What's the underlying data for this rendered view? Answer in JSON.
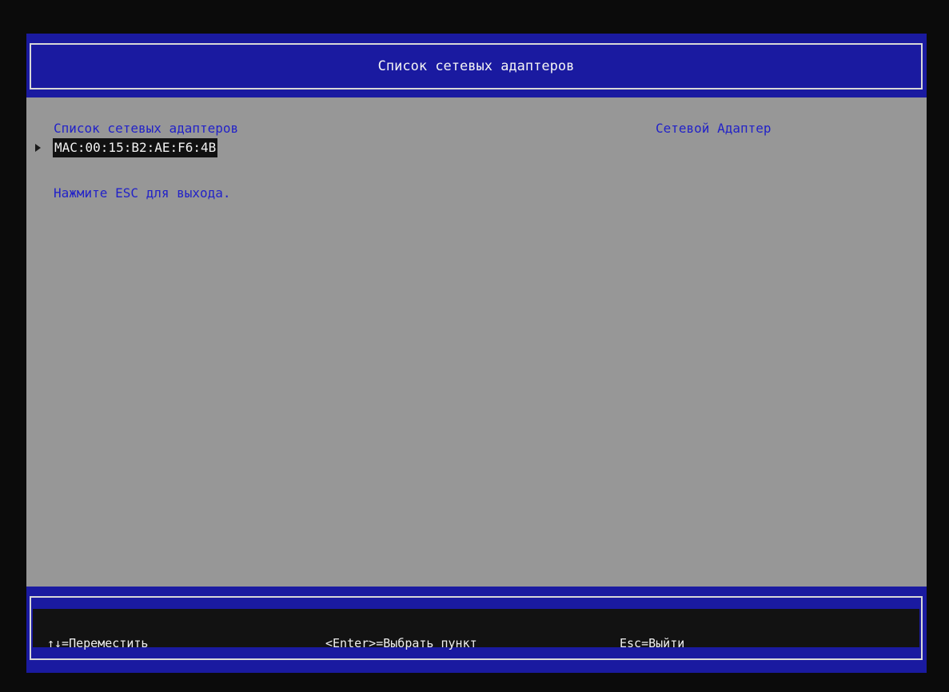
{
  "header": {
    "title": "Список сетевых адаптеров"
  },
  "main": {
    "list_title": "Список сетевых адаптеров",
    "items": [
      {
        "label": "MAC:00:15:B2:AE:F6:4B"
      }
    ],
    "hint": "Нажмите ESC для выхода.",
    "help_title": "Сетевой Адаптер"
  },
  "footer": {
    "move": "↑↓=Переместить",
    "select": "<Enter>=Выбрать пункт",
    "exit": "Esc=Выйти"
  },
  "colors": {
    "frame_blue": "#1a1aa0",
    "body_gray": "#979797",
    "text_blue": "#2222c8",
    "highlight_bg": "#111111"
  }
}
